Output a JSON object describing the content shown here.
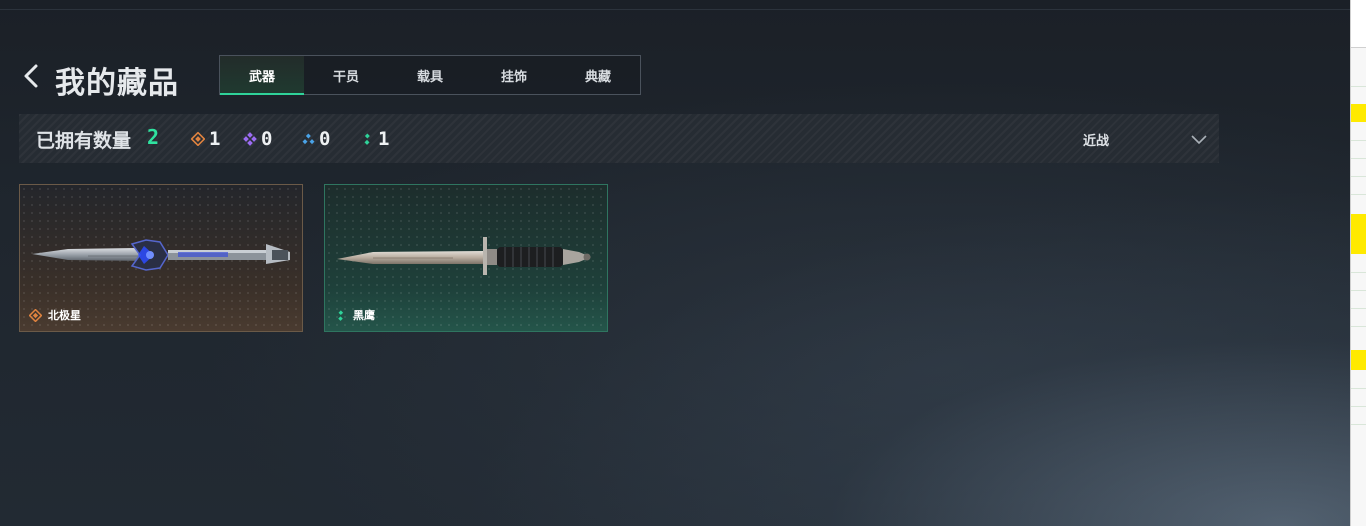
{
  "header": {
    "title": "我的藏品",
    "tabs": [
      {
        "label": "武器",
        "active": true
      },
      {
        "label": "干员",
        "active": false
      },
      {
        "label": "载具",
        "active": false
      },
      {
        "label": "挂饰",
        "active": false
      },
      {
        "label": "典藏",
        "active": false
      }
    ]
  },
  "stats": {
    "owned_label": "已拥有数量",
    "owned_count": "2",
    "rarities": [
      {
        "icon": "orange-diamond-icon",
        "color": "#e0833f",
        "count": "1"
      },
      {
        "icon": "purple-diamond-icon",
        "color": "#9b6cf2",
        "count": "0"
      },
      {
        "icon": "blue-triangle-icon",
        "color": "#4aa3e8",
        "count": "0"
      },
      {
        "icon": "green-dots-icon",
        "color": "#2fd39a",
        "count": "1"
      }
    ],
    "sort_value": "近战"
  },
  "items": [
    {
      "name": "北极星",
      "rarity_icon": "orange-diamond-icon",
      "rarity_color": "#e0833f"
    },
    {
      "name": "黑鹰",
      "rarity_icon": "green-dots-icon",
      "rarity_color": "#2fd39a"
    }
  ],
  "colors": {
    "accent": "#2fd39a",
    "background": "#1f262e"
  }
}
